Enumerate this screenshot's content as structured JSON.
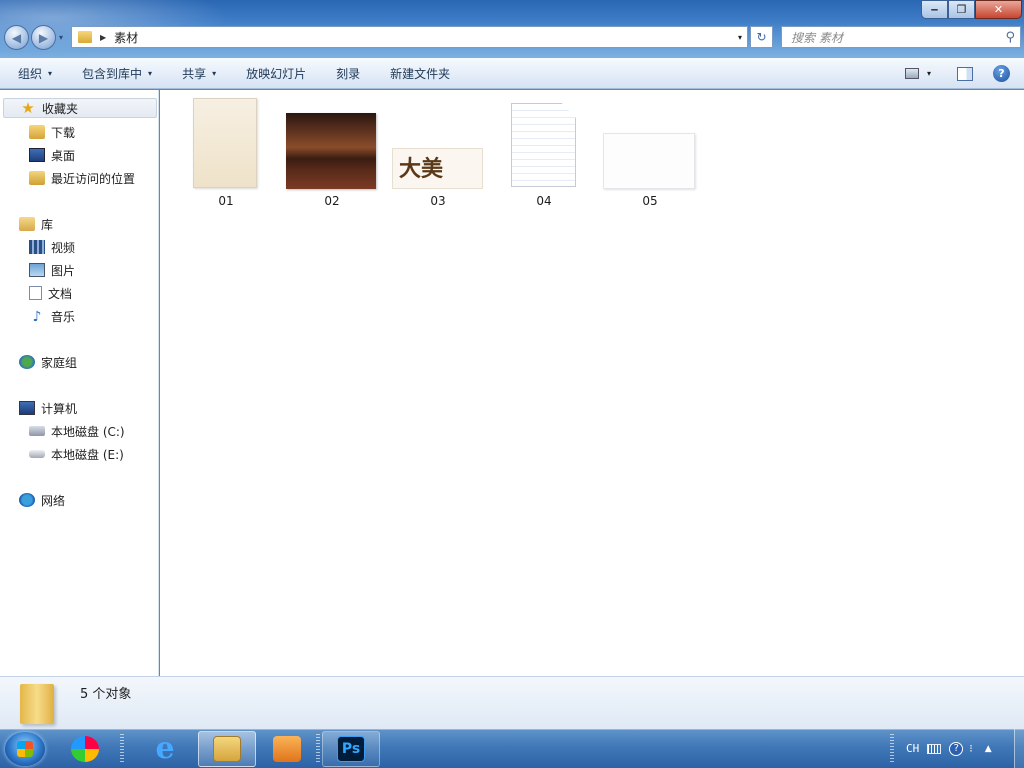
{
  "window": {
    "controls": {
      "minimize": "‒",
      "maximize": "❐",
      "close": "✕"
    }
  },
  "nav": {
    "back_icon": "◀",
    "forward_icon": "▶",
    "dropdown": "▾"
  },
  "address": {
    "breadcrumb": "素材",
    "arrow": "▶",
    "dropdown": "▾",
    "refresh": "↻"
  },
  "search": {
    "placeholder": "搜索 素材",
    "icon": "⚲"
  },
  "toolbar": {
    "organize": "组织",
    "include_library": "包含到库中",
    "share": "共享",
    "slideshow": "放映幻灯片",
    "burn": "刻录",
    "new_folder": "新建文件夹",
    "dd": "▾",
    "help": "?"
  },
  "sidebar": {
    "favorites": {
      "label": "收藏夹",
      "items": [
        "下载",
        "桌面",
        "最近访问的位置"
      ]
    },
    "libraries": {
      "label": "库",
      "items": [
        "视频",
        "图片",
        "文档",
        "音乐"
      ]
    },
    "homegroup": {
      "label": "家庭组"
    },
    "computer": {
      "label": "计算机",
      "items": [
        "本地磁盘 (C:)",
        "本地磁盘 (E:)"
      ]
    },
    "network": {
      "label": "网络"
    }
  },
  "files": [
    {
      "name": "01"
    },
    {
      "name": "02"
    },
    {
      "name": "03",
      "thumb_text": "大美"
    },
    {
      "name": "04"
    },
    {
      "name": "05"
    }
  ],
  "details": {
    "count": "5 个对象"
  },
  "taskbar": {
    "ps_label": "Ps",
    "ie_label": "e",
    "tray": {
      "lang": "CH",
      "help": "?",
      "options": "⁝",
      "show_hidden": "▲"
    }
  },
  "colors": {
    "accent": "#3d7cc6",
    "taskbar": "#3f77b7",
    "toolbar": "#e6eef9"
  }
}
